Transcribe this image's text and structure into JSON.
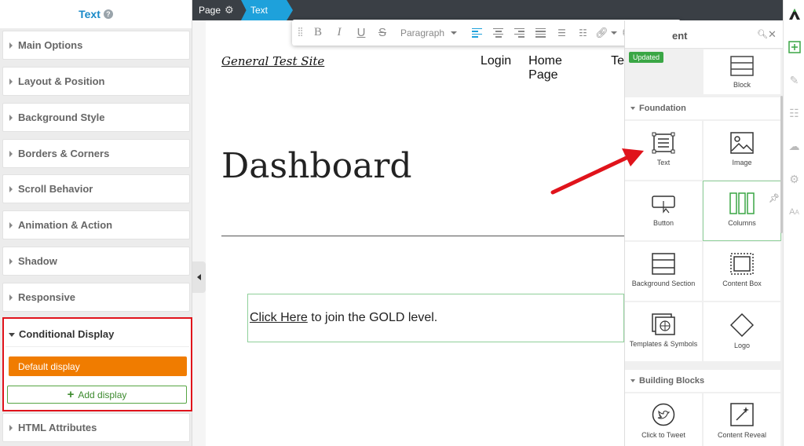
{
  "left_panel": {
    "title": "Text",
    "sections": [
      {
        "label": "Main Options"
      },
      {
        "label": "Layout & Position"
      },
      {
        "label": "Background Style"
      },
      {
        "label": "Borders & Corners"
      },
      {
        "label": "Scroll Behavior"
      },
      {
        "label": "Animation & Action"
      },
      {
        "label": "Shadow"
      },
      {
        "label": "Responsive"
      }
    ],
    "conditional_display": {
      "label": "Conditional Display",
      "default_display": "Default display",
      "add_display": "Add display"
    },
    "html_attributes": "HTML Attributes"
  },
  "breadcrumb": {
    "page": "Page",
    "text": "Text"
  },
  "toolbar": {
    "paragraph": "Paragraph"
  },
  "canvas": {
    "site_title": "General Test Site",
    "nav": [
      "Login",
      "Home Page",
      "Te"
    ],
    "heading": "Dashboard",
    "cta_link": "Click Here",
    "cta_rest": " to join the GOLD level."
  },
  "element_panel": {
    "title": "ent",
    "updated_badge": "Updated",
    "block_label": "Block",
    "categories": {
      "foundation": "Foundation",
      "building_blocks": "Building Blocks"
    },
    "tiles": {
      "text": "Text",
      "image": "Image",
      "button": "Button",
      "columns": "Columns",
      "background_section": "Background Section",
      "content_box": "Content Box",
      "templates_symbols": "Templates & Symbols",
      "logo": "Logo",
      "click_to_tweet": "Click to Tweet",
      "content_reveal": "Content Reveal"
    }
  },
  "colors": {
    "accent_blue": "#1ea1db",
    "highlight_red": "#e0131b",
    "default_display_orange": "#f07c00",
    "add_green": "#3c8a2e",
    "updated_green": "#3aa645"
  }
}
